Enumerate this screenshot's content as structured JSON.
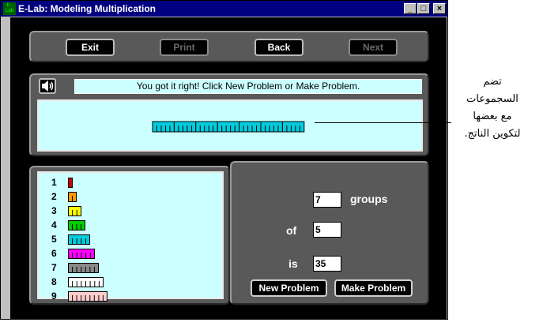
{
  "window": {
    "title": "E-Lab: Modeling Multiplication",
    "app_icon_text": "E-\nLab",
    "min_glyph": "_",
    "max_glyph": "□",
    "close_glyph": "×"
  },
  "toolbar": {
    "exit_label": "Exit",
    "print_label": "Print",
    "back_label": "Back",
    "next_label": "Next"
  },
  "message": "You got it right!  Click New Problem or Make Problem.",
  "workspace": {
    "row_rods": 7,
    "units_per_rod": 5,
    "rod_color": "#00ccdd"
  },
  "rods": [
    {
      "label": "1",
      "units": 1,
      "color": "#cc0000"
    },
    {
      "label": "2",
      "units": 2,
      "color": "#ff9900"
    },
    {
      "label": "3",
      "units": 3,
      "color": "#ffff00"
    },
    {
      "label": "4",
      "units": 4,
      "color": "#00cc00"
    },
    {
      "label": "5",
      "units": 5,
      "color": "#00ccdd"
    },
    {
      "label": "6",
      "units": 6,
      "color": "#ff00ff"
    },
    {
      "label": "7",
      "units": 7,
      "color": "#888888"
    },
    {
      "label": "8",
      "units": 8,
      "color": "#ffffff"
    },
    {
      "label": "9",
      "units": 9,
      "color": "#ffcccc"
    }
  ],
  "problem": {
    "groups_value": "7",
    "groups_label": "groups",
    "of_label": "of",
    "of_value": "5",
    "is_label": "is",
    "is_value": "35"
  },
  "actions": {
    "new_problem_label": "New Problem",
    "make_problem_label": "Make Problem"
  },
  "annotation": {
    "line1": "تضم",
    "line2": "السجموعات",
    "line3": "مع بعضها",
    "line4": "لتكوين الناتج."
  }
}
